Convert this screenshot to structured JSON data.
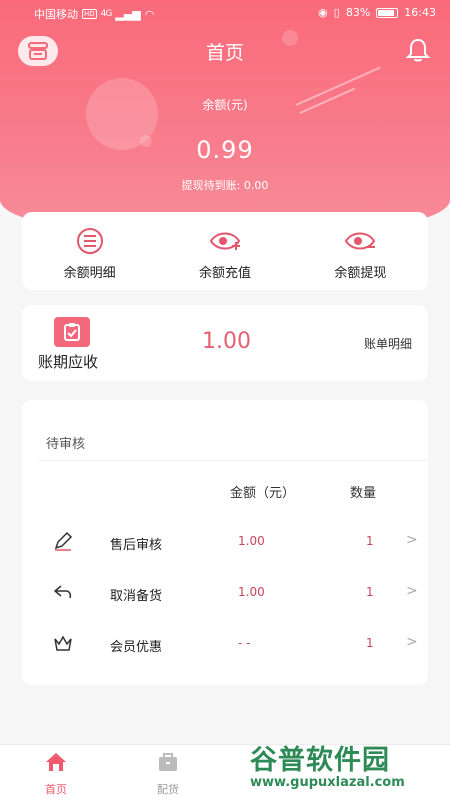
{
  "status_bar": {
    "carrier": "中国移动",
    "hd": "HD",
    "signal": "4G",
    "battery": "83%",
    "time": "16:43"
  },
  "header": {
    "title": "首页",
    "left_icon": "store-icon",
    "right_icon": "bell-icon"
  },
  "balance": {
    "label": "余额(元)",
    "value": "0.99",
    "pending": "提现待到账: 0.00"
  },
  "actions": [
    {
      "label": "余额明细",
      "icon": "list-icon"
    },
    {
      "label": "余额充值",
      "icon": "eye-plus-icon"
    },
    {
      "label": "余额提现",
      "icon": "eye-minus-icon"
    }
  ],
  "receivable": {
    "label": "账期应收",
    "value": "1.00",
    "link": "账单明细",
    "icon": "clipboard-check-icon"
  },
  "review": {
    "title": "待审核",
    "col_amount": "金额（元）",
    "col_qty": "数量",
    "rows": [
      {
        "name": "售后审核",
        "amount": "1.00",
        "qty": "1",
        "icon": "pen-icon"
      },
      {
        "name": "取消备货",
        "amount": "1.00",
        "qty": "1",
        "icon": "return-icon"
      },
      {
        "name": "会员优惠",
        "amount": "- -",
        "qty": "1",
        "icon": "crown-icon"
      }
    ],
    "chevron": ">"
  },
  "tabs": [
    {
      "label": "首页",
      "icon": "home-icon",
      "active": true
    },
    {
      "label": "配货",
      "icon": "bag-icon",
      "active": false
    }
  ],
  "watermark": {
    "title": "谷普软件园",
    "url": "www.gupuxlazal.com"
  },
  "colors": {
    "brand": "#f8697b",
    "value_text": "#e46073",
    "active_tab": "#f05a6e"
  }
}
